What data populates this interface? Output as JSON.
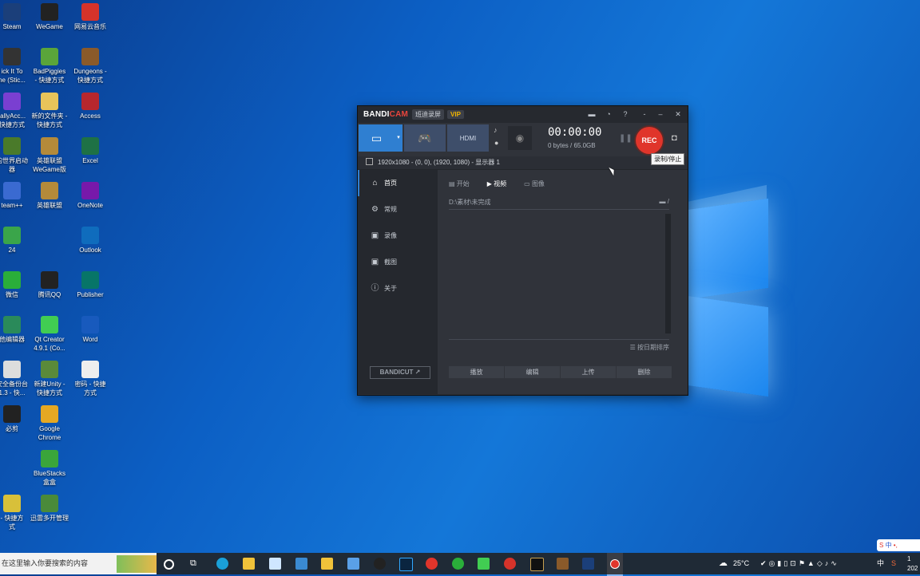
{
  "desktop": {
    "icons": [
      {
        "label": "Steam",
        "color": "#1b3f7a"
      },
      {
        "label": "WeGame",
        "color": "#222"
      },
      {
        "label": "网易云音乐",
        "color": "#d6332a"
      },
      {
        "label": "ick It To\nne (Stic...",
        "color": "#333"
      },
      {
        "label": "BadPiggies\n- 快捷方式",
        "color": "#5aa53a"
      },
      {
        "label": "Dungeons -\n快捷方式",
        "color": "#8a5a2a"
      },
      {
        "label": "tallyAcc...\n快捷方式",
        "color": "#7a3fd1"
      },
      {
        "label": "新的文件夹 -\n快捷方式",
        "color": "#e8c45a"
      },
      {
        "label": "Access",
        "color": "#b7272d"
      },
      {
        "label": "的世界启动\n器",
        "color": "#4a7a2a"
      },
      {
        "label": "英雄联盟\nWeGame版",
        "color": "#b48a3a"
      },
      {
        "label": "Excel",
        "color": "#1e7145"
      },
      {
        "label": "team++",
        "color": "#3a6ad1"
      },
      {
        "label": "英雄联盟",
        "color": "#b48a3a"
      },
      {
        "label": "OneNote",
        "color": "#7719aa"
      },
      {
        "label": "24",
        "color": "#3aa54a"
      },
      {
        "label": "Outlook",
        "color": "#0f6cbd"
      },
      {
        "label": "微信",
        "color": "#2aae3a"
      },
      {
        "label": "腾讯QQ",
        "color": "#222"
      },
      {
        "label": "Publisher",
        "color": "#077568"
      },
      {
        "label": "他编辑器",
        "color": "#2a8a5a"
      },
      {
        "label": "Qt Creator\n4.9.1 (Co...",
        "color": "#41cd52"
      },
      {
        "label": "Word",
        "color": "#185abd"
      },
      {
        "label": "安全备份台\n1.3 - 快...",
        "color": "#ddd"
      },
      {
        "label": "新建Unity -\n快捷方式",
        "color": "#5a8a3a"
      },
      {
        "label": "密码 - 快捷\n方式",
        "color": "#eee"
      },
      {
        "label": "必剪",
        "color": "#222"
      },
      {
        "label": "Google\nChrome",
        "color": "#e5a823"
      },
      {
        "label": "BlueStacks\n盒盒",
        "color": "#3aa53a"
      },
      {
        "label": "- 快捷方\n式",
        "color": "#d8c03a"
      },
      {
        "label": "迅雷多开管理",
        "color": "#4a8a3a"
      }
    ]
  },
  "bandicam": {
    "brand_bandi": "BANDI",
    "brand_cam": "CAM",
    "badge": "班迪录屏",
    "vip": "VIP",
    "timer": "00:00:00",
    "size": "0 bytes / 65.0GB",
    "rec": "REC",
    "tooltip": "录制/停止",
    "area": "1920x1080 - (0, 0), (1920, 1080) - 显示器 1",
    "nav": [
      "首页",
      "常规",
      "录像",
      "截图",
      "关于"
    ],
    "bandicut": "BANDICUT ↗",
    "tabs": [
      "开始",
      "视频",
      "图像"
    ],
    "path": "D:\\素材\\未完成",
    "path_btn": "/",
    "sort": "按日期排序",
    "actions": [
      "播放",
      "编辑",
      "上传",
      "删除"
    ]
  },
  "taskbar": {
    "search_placeholder": "在这里输入你要搜索的内容",
    "weather": "25°C",
    "ime": "中",
    "time_fragment": "1",
    "date_fragment": "202"
  },
  "colors": {
    "accent": "#2f7fd1",
    "rec": "#e0352b",
    "vip": "#f0b400"
  }
}
